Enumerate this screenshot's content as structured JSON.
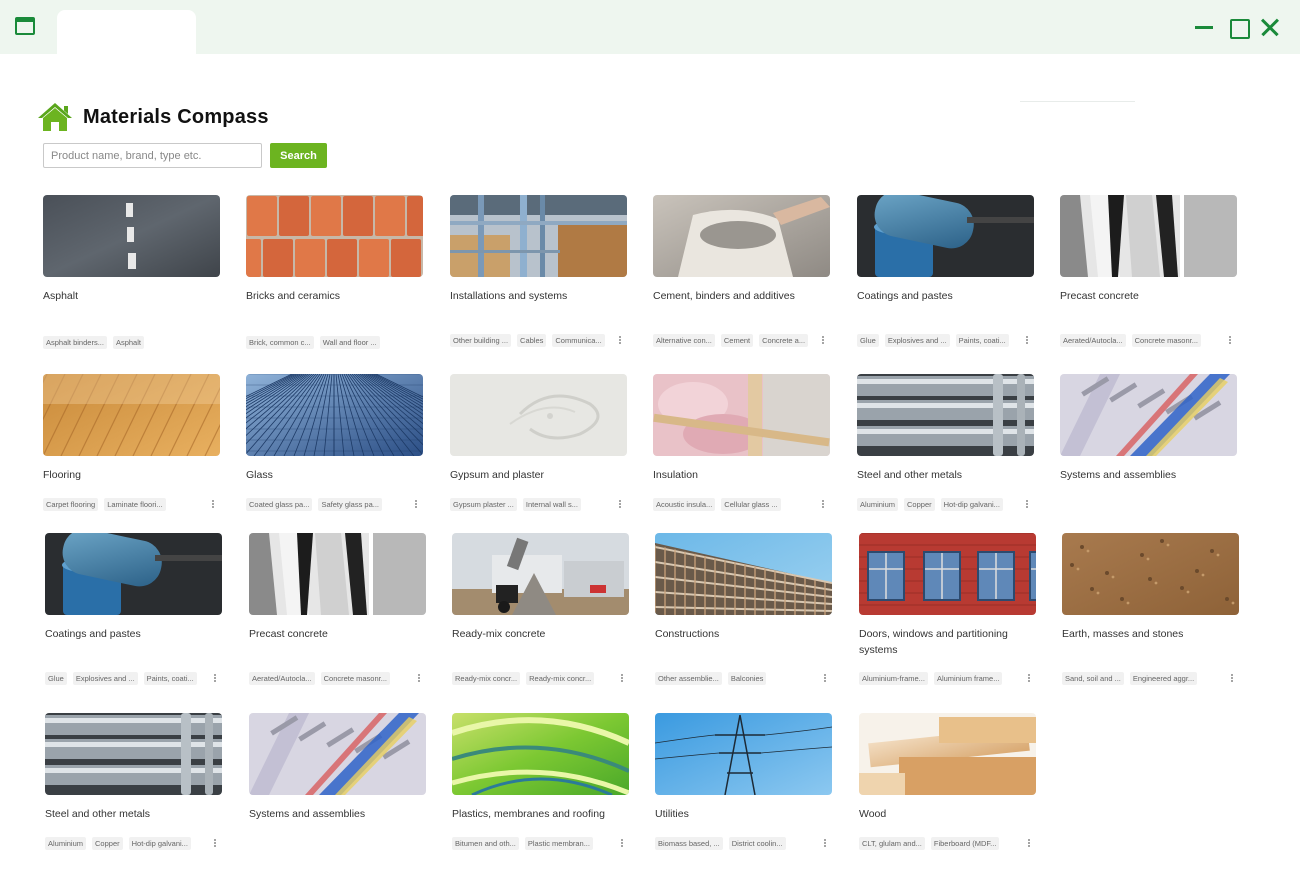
{
  "app": {
    "title": "Materials Compass"
  },
  "search": {
    "placeholder": "Product name, brand, type etc.",
    "button_label": "Search"
  },
  "categories": [
    {
      "title": "Asphalt",
      "tags": [
        "Asphalt binders...",
        "Asphalt"
      ],
      "more": false,
      "image": "asphalt"
    },
    {
      "title": "Bricks and ceramics",
      "tags": [
        "Brick, common c...",
        "Wall and floor ..."
      ],
      "more": false,
      "image": "bricks"
    },
    {
      "title": "Installations and systems",
      "tags": [
        "Other building ...",
        "Cables",
        "Communica..."
      ],
      "more": true,
      "image": "installations"
    },
    {
      "title": "Cement, binders and additives",
      "tags": [
        "Alternative con...",
        "Cement",
        "Concrete a..."
      ],
      "more": true,
      "image": "cement"
    },
    {
      "title": "Coatings and pastes",
      "tags": [
        "Glue",
        "Explosives and ...",
        "Paints, coati..."
      ],
      "more": true,
      "image": "coatings"
    },
    {
      "title": "Precast concrete",
      "tags": [
        "Aerated/Autocla...",
        "Concrete masonr..."
      ],
      "more": true,
      "image": "precast"
    },
    {
      "title": "Flooring",
      "tags": [
        "Carpet flooring",
        "Laminate floori..."
      ],
      "more": true,
      "image": "flooring"
    },
    {
      "title": "Glass",
      "tags": [
        "Coated glass pa...",
        "Safety glass pa..."
      ],
      "more": true,
      "image": "glass"
    },
    {
      "title": "Gypsum and plaster",
      "tags": [
        "Gypsum plaster ...",
        "Internal wall s..."
      ],
      "more": true,
      "image": "gypsum"
    },
    {
      "title": "Insulation",
      "tags": [
        "Acoustic insula...",
        "Cellular glass ..."
      ],
      "more": true,
      "image": "insulation"
    },
    {
      "title": "Steel and other metals",
      "tags": [
        "Aluminium",
        "Copper",
        "Hot-dip galvani..."
      ],
      "more": true,
      "image": "steel"
    },
    {
      "title": "Systems and assemblies",
      "tags": [],
      "more": false,
      "image": "systems"
    },
    {
      "title": "Coatings and pastes",
      "tags": [
        "Glue",
        "Explosives and ...",
        "Paints, coati..."
      ],
      "more": true,
      "image": "coatings"
    },
    {
      "title": "Precast concrete",
      "tags": [
        "Aerated/Autocla...",
        "Concrete masonr..."
      ],
      "more": true,
      "image": "precast"
    },
    {
      "title": "Ready-mix concrete",
      "tags": [
        "Ready-mix concr...",
        "Ready-mix concr..."
      ],
      "more": true,
      "image": "readymix"
    },
    {
      "title": "Constructions",
      "tags": [
        "Other assemblie...",
        "Balconies"
      ],
      "more": true,
      "image": "constructions"
    },
    {
      "title": "Doors, windows and partitioning systems",
      "tags": [
        "Aluminium-frame...",
        "Aluminium frame..."
      ],
      "more": true,
      "image": "doors"
    },
    {
      "title": "Earth, masses and stones",
      "tags": [
        "Sand, soil and ...",
        "Engineered aggr..."
      ],
      "more": true,
      "image": "earth"
    },
    {
      "title": "Steel and other metals",
      "tags": [
        "Aluminium",
        "Copper",
        "Hot-dip galvani..."
      ],
      "more": true,
      "image": "steel"
    },
    {
      "title": "Systems and assemblies",
      "tags": [],
      "more": false,
      "image": "systems"
    },
    {
      "title": "Plastics, membranes and roofing",
      "tags": [
        "Bitumen and oth...",
        "Plastic membran..."
      ],
      "more": true,
      "image": "plastics"
    },
    {
      "title": "Utilities",
      "tags": [
        "Biomass based, ...",
        "District coolin..."
      ],
      "more": true,
      "image": "utilities"
    },
    {
      "title": "Wood",
      "tags": [
        "CLT, glulam and...",
        "Fiberboard (MDF..."
      ],
      "more": true,
      "image": "wood"
    }
  ],
  "colors": {
    "accent": "#6cb420",
    "window_chrome": "#1a8a3a",
    "titlebar_bg": "#eef6ef"
  }
}
